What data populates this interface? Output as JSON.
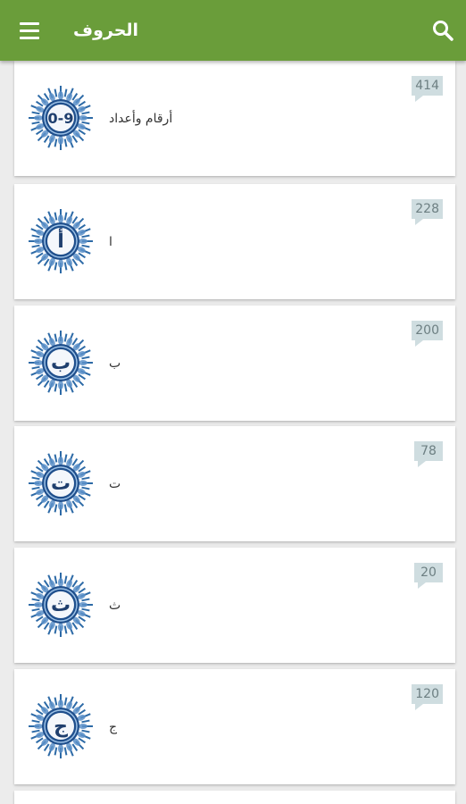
{
  "appbar": {
    "title": "الحروف",
    "menu_icon": "hamburger-menu-icon",
    "search_icon": "search-icon",
    "color": "#6a9d3a"
  },
  "items": [
    {
      "badge": "0-9",
      "label": "أرقام وأعداد",
      "count": "414"
    },
    {
      "badge": "أ",
      "label": "ا",
      "count": "228"
    },
    {
      "badge": "ب",
      "label": "ب",
      "count": "200"
    },
    {
      "badge": "ت",
      "label": "ت",
      "count": "78"
    },
    {
      "badge": "ث",
      "label": "ث",
      "count": "20"
    },
    {
      "badge": "ج",
      "label": "ج",
      "count": "120"
    }
  ]
}
